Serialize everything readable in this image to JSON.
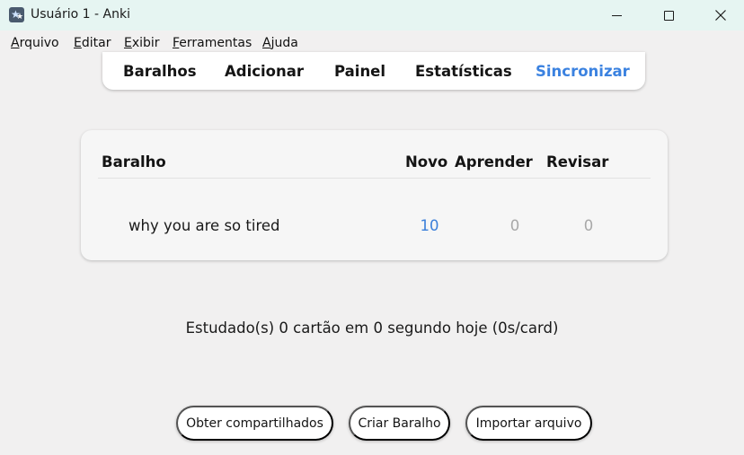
{
  "window": {
    "title": "Usuário 1 - Anki"
  },
  "menu": {
    "items": [
      {
        "first": "A",
        "rest": "rquivo"
      },
      {
        "first": "E",
        "rest": "ditar"
      },
      {
        "first": "E",
        "rest": "xibir"
      },
      {
        "first": "F",
        "rest": "erramentas"
      },
      {
        "first": "A",
        "rest": "juda"
      }
    ]
  },
  "toolbar": {
    "decks": "Baralhos",
    "add": "Adicionar",
    "browse": "Painel",
    "stats": "Estatísticas",
    "sync": "Sincronizar",
    "sync_color": "#3b82e0"
  },
  "deck_table": {
    "headers": {
      "deck": "Baralho",
      "new": "Novo",
      "learn": "Aprender",
      "review": "Revisar"
    },
    "rows": [
      {
        "name": "why you are so tired",
        "new": "10",
        "learn": "0",
        "review": "0"
      }
    ],
    "colors": {
      "new": "#3b7fd9",
      "zero": "#a8a8a8"
    }
  },
  "study_stats": "Estudado(s) 0 cartão em 0 segundo hoje (0s/card)",
  "buttons": {
    "shared": "Obter compartilhados",
    "create": "Criar Baralho",
    "import": "Importar arquivo"
  }
}
